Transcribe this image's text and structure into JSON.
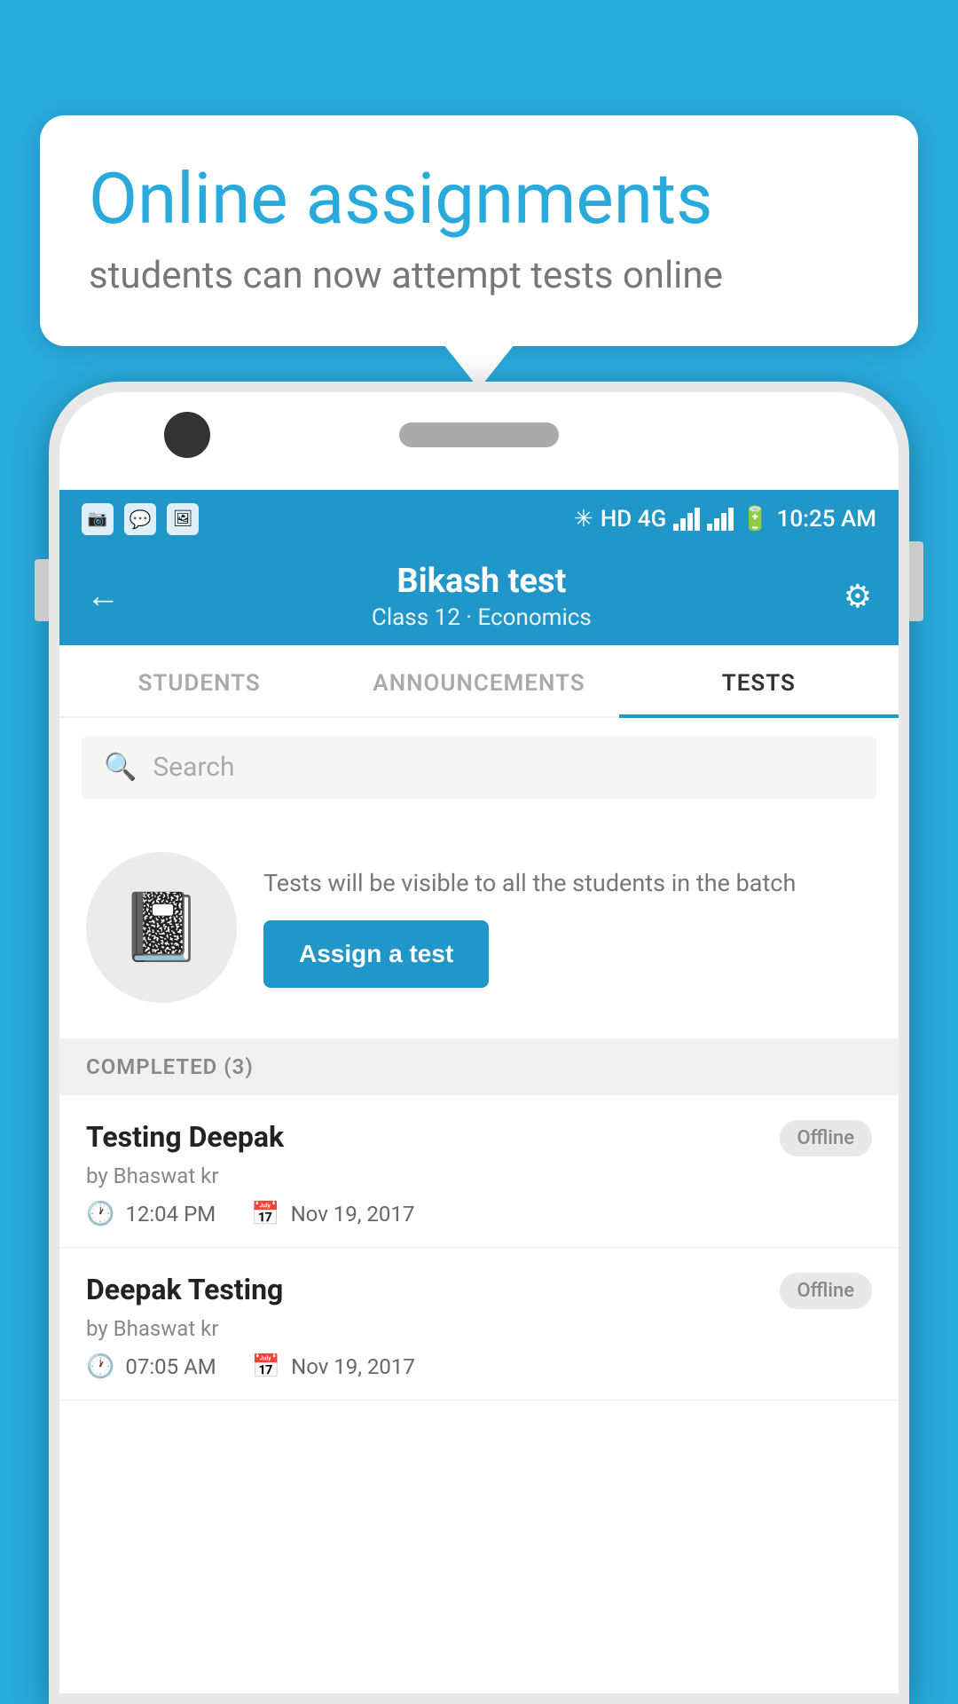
{
  "background": {
    "color": "#29aadc"
  },
  "bubble": {
    "title": "Online assignments",
    "subtitle": "students can now attempt tests online"
  },
  "status_bar": {
    "icons": [
      "app1",
      "whatsapp",
      "photo"
    ],
    "network": "HD 4G",
    "time": "10:25 AM"
  },
  "app_bar": {
    "title": "Bikash test",
    "subtitle": "Class 12 · Economics",
    "back_label": "←",
    "settings_label": "⚙"
  },
  "tabs": [
    {
      "label": "STUDENTS",
      "active": false
    },
    {
      "label": "ANNOUNCEMENTS",
      "active": false
    },
    {
      "label": "TESTS",
      "active": true
    }
  ],
  "search": {
    "placeholder": "Search"
  },
  "assign_section": {
    "description": "Tests will be visible to all the students in the batch",
    "button_label": "Assign a test"
  },
  "completed_section": {
    "header": "COMPLETED (3)",
    "items": [
      {
        "name": "Testing Deepak",
        "author": "by Bhaswat kr",
        "time": "12:04 PM",
        "date": "Nov 19, 2017",
        "status": "Offline"
      },
      {
        "name": "Deepak Testing",
        "author": "by Bhaswat kr",
        "time": "07:05 AM",
        "date": "Nov 19, 2017",
        "status": "Offline"
      }
    ]
  }
}
